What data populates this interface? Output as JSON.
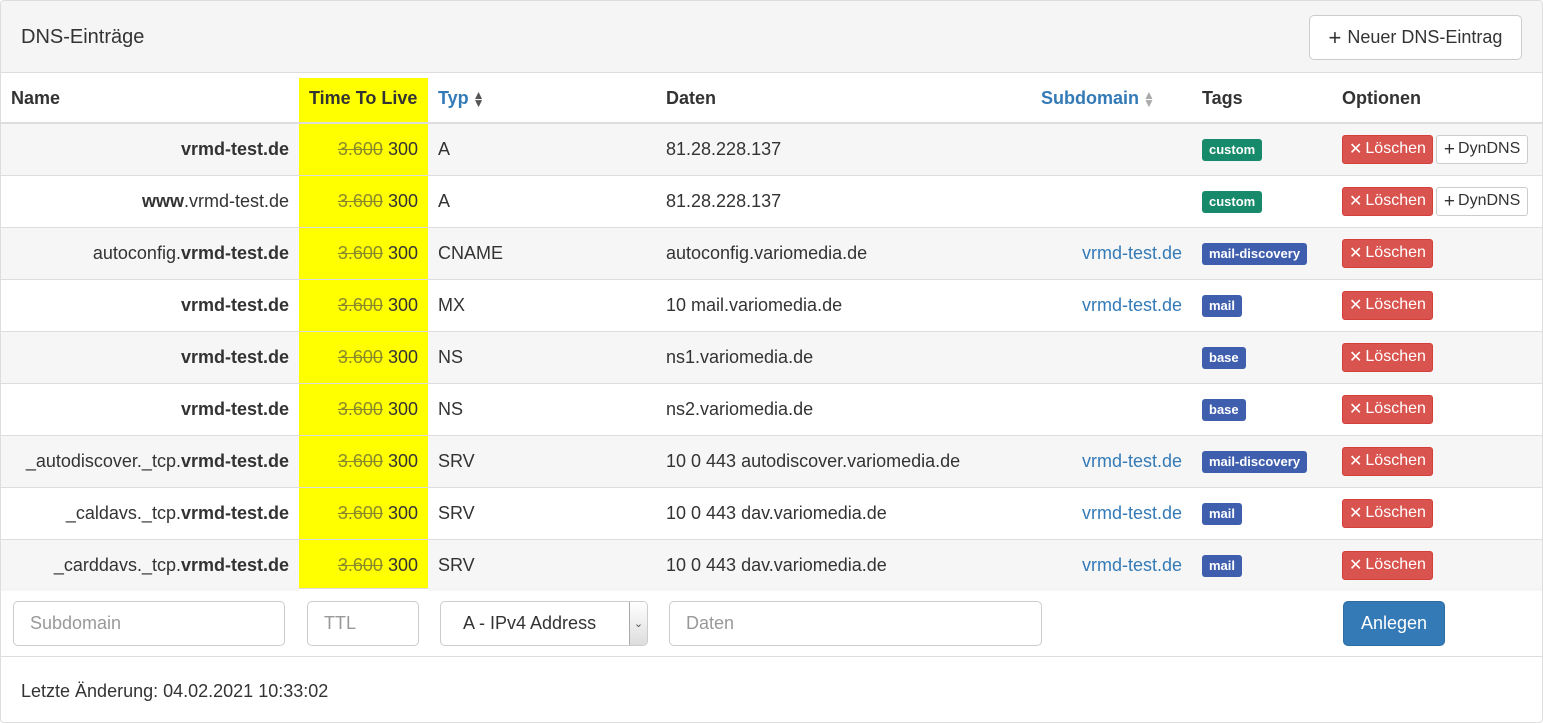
{
  "header": {
    "title": "DNS-Einträge",
    "new_button": "Neuer DNS-Eintrag"
  },
  "columns": {
    "name": "Name",
    "ttl": "Time To Live",
    "type": "Typ",
    "data": "Daten",
    "subdomain": "Subdomain",
    "tags": "Tags",
    "options": "Optionen"
  },
  "colors": {
    "ttl_highlight": "#ffff00",
    "tag_custom": "#168a6a",
    "tag_mail": "#3f5fae",
    "delete": "#d9534f",
    "primary": "#337ab7",
    "link": "#337ab7"
  },
  "delete_label": "Löschen",
  "dyndns_label": "DynDNS",
  "rows": [
    {
      "name_prefix": "",
      "name_bold": "vrmd-test.de",
      "name_suffix": "",
      "ttl_old": "3.600",
      "ttl_new": "300",
      "type": "A",
      "data": "81.28.228.137",
      "subdomain": "",
      "tag": "custom",
      "tag_color": "#168a6a",
      "dyndns": true
    },
    {
      "name_prefix": "www",
      "name_bold": "",
      "name_suffix": ".vrmd-test.de",
      "ttl_old": "3.600",
      "ttl_new": "300",
      "type": "A",
      "data": "81.28.228.137",
      "subdomain": "",
      "tag": "custom",
      "tag_color": "#168a6a",
      "dyndns": true
    },
    {
      "name_prefix": "autoconfig.",
      "name_bold": "vrmd-test.de",
      "name_suffix": "",
      "ttl_old": "3.600",
      "ttl_new": "300",
      "type": "CNAME",
      "data": "autoconfig.variomedia.de",
      "subdomain": "vrmd-test.de",
      "tag": "mail-discovery",
      "tag_color": "#3f5fae",
      "dyndns": false
    },
    {
      "name_prefix": "",
      "name_bold": "vrmd-test.de",
      "name_suffix": "",
      "ttl_old": "3.600",
      "ttl_new": "300",
      "type": "MX",
      "data": "10 mail.variomedia.de",
      "subdomain": "vrmd-test.de",
      "tag": "mail",
      "tag_color": "#3f5fae",
      "dyndns": false
    },
    {
      "name_prefix": "",
      "name_bold": "vrmd-test.de",
      "name_suffix": "",
      "ttl_old": "3.600",
      "ttl_new": "300",
      "type": "NS",
      "data": "ns1.variomedia.de",
      "subdomain": "",
      "tag": "base",
      "tag_color": "#3f5fae",
      "dyndns": false
    },
    {
      "name_prefix": "",
      "name_bold": "vrmd-test.de",
      "name_suffix": "",
      "ttl_old": "3.600",
      "ttl_new": "300",
      "type": "NS",
      "data": "ns2.variomedia.de",
      "subdomain": "",
      "tag": "base",
      "tag_color": "#3f5fae",
      "dyndns": false
    },
    {
      "name_prefix": "_autodiscover._tcp.",
      "name_bold": "vrmd-test.de",
      "name_suffix": "",
      "ttl_old": "3.600",
      "ttl_new": "300",
      "type": "SRV",
      "data": "10 0 443 autodiscover.variomedia.de",
      "subdomain": "vrmd-test.de",
      "tag": "mail-discovery",
      "tag_color": "#3f5fae",
      "dyndns": false
    },
    {
      "name_prefix": "_caldavs._tcp.",
      "name_bold": "vrmd-test.de",
      "name_suffix": "",
      "ttl_old": "3.600",
      "ttl_new": "300",
      "type": "SRV",
      "data": "10 0 443 dav.variomedia.de",
      "subdomain": "vrmd-test.de",
      "tag": "mail",
      "tag_color": "#3f5fae",
      "dyndns": false
    },
    {
      "name_prefix": "_carddavs._tcp.",
      "name_bold": "vrmd-test.de",
      "name_suffix": "",
      "ttl_old": "3.600",
      "ttl_new": "300",
      "type": "SRV",
      "data": "10 0 443 dav.variomedia.de",
      "subdomain": "vrmd-test.de",
      "tag": "mail",
      "tag_color": "#3f5fae",
      "dyndns": false
    }
  ],
  "form": {
    "subdomain_placeholder": "Subdomain",
    "ttl_placeholder": "TTL",
    "type_selected": "A - IPv4 Address",
    "data_placeholder": "Daten",
    "create_button": "Anlegen"
  },
  "footer": {
    "last_change": "Letzte Änderung: 04.02.2021 10:33:02"
  }
}
